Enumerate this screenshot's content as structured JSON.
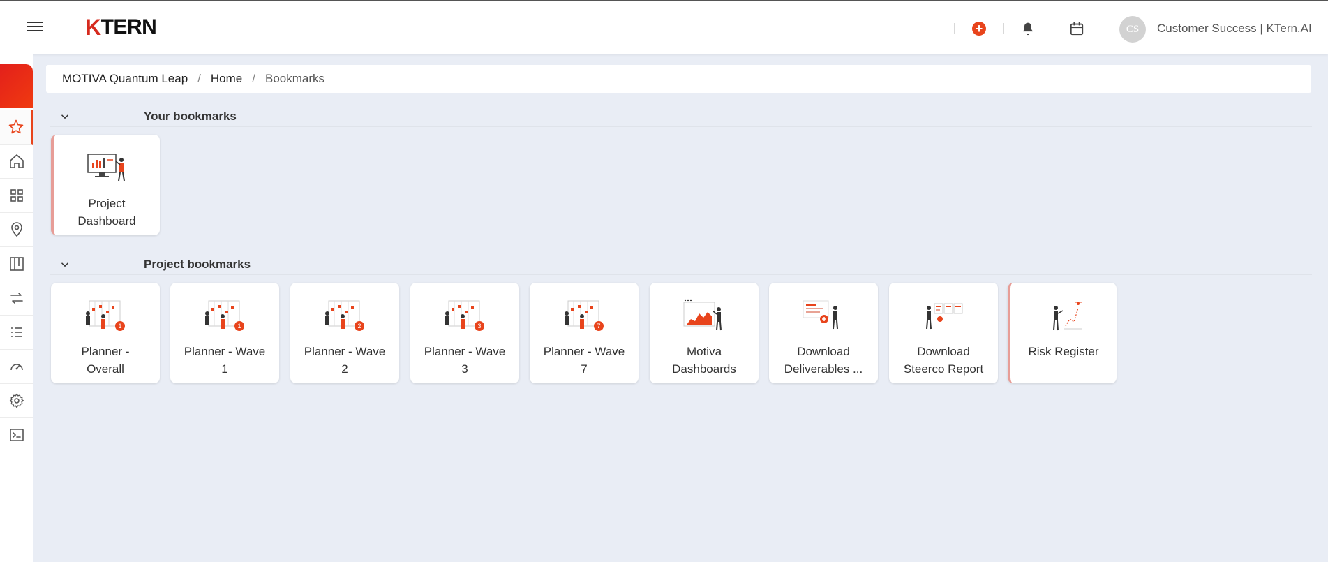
{
  "header": {
    "logo_k": "K",
    "logo_rest": "TERN",
    "avatar_initials": "CS",
    "user_name": "Customer Success | KTern.AI",
    "accent": "#e8441c"
  },
  "breadcrumb": {
    "items": [
      "MOTIVA Quantum Leap",
      "Home",
      "Bookmarks"
    ],
    "separator": "/"
  },
  "sidebar": {
    "icons": [
      "star-icon",
      "home-icon",
      "grid-icon",
      "location-pin-icon",
      "kanban-icon",
      "transfer-icon",
      "list-icon",
      "speedometer-icon",
      "gear-icon",
      "terminal-icon"
    ]
  },
  "your_bookmarks": {
    "title": "Your bookmarks",
    "cards": [
      {
        "line1": "Project",
        "line2": "Dashboard"
      }
    ]
  },
  "project_bookmarks": {
    "title": "Project bookmarks",
    "cards": [
      {
        "line1": "Planner -",
        "line2": "Overall",
        "badge": "1"
      },
      {
        "line1": "Planner - Wave",
        "line2": "1",
        "badge": "1"
      },
      {
        "line1": "Planner - Wave",
        "line2": "2",
        "badge": "2"
      },
      {
        "line1": "Planner - Wave",
        "line2": "3",
        "badge": "3"
      },
      {
        "line1": "Planner - Wave",
        "line2": "7",
        "badge": "7"
      },
      {
        "line1": "Motiva",
        "line2": "Dashboards"
      },
      {
        "line1": "Download",
        "line2": "Deliverables ..."
      },
      {
        "line1": "Download",
        "line2": "Steerco Report"
      },
      {
        "line1": "Risk Register",
        "line2": ""
      }
    ]
  }
}
